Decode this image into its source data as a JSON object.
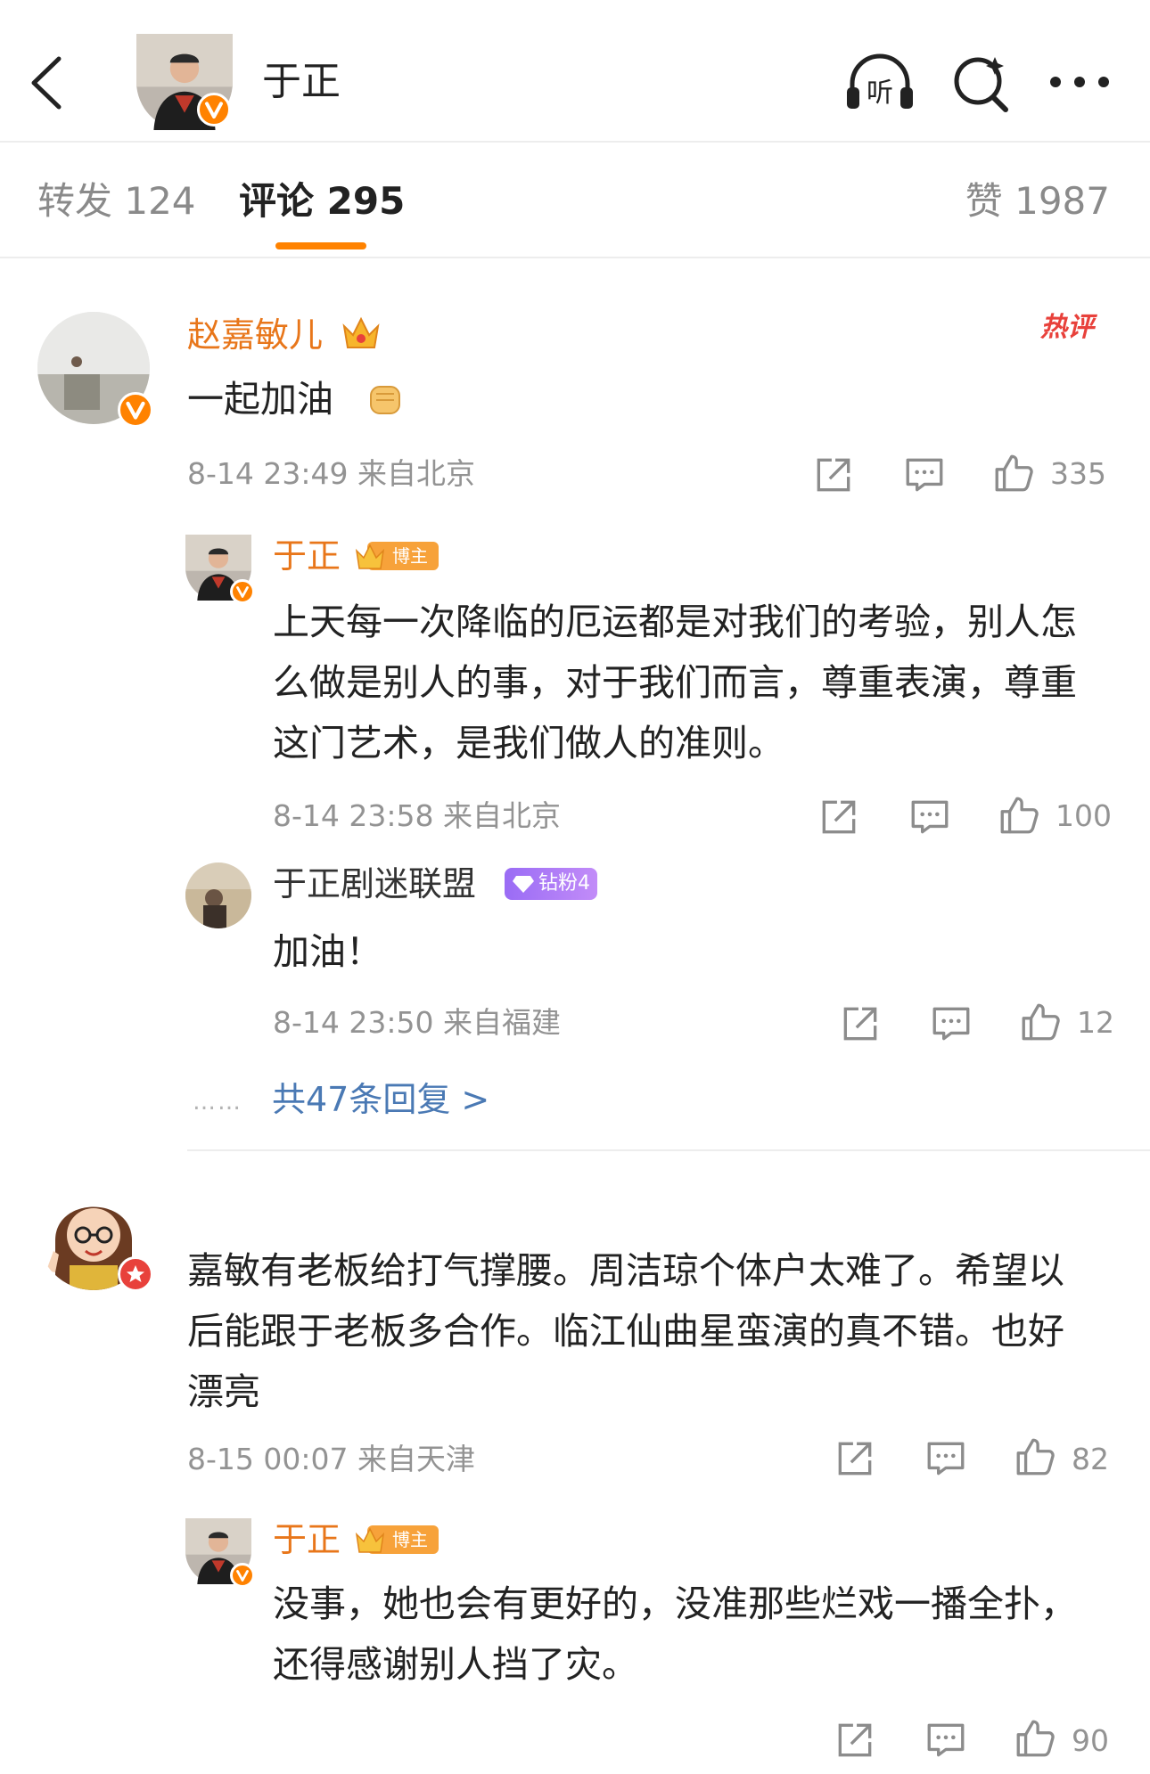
{
  "header": {
    "title": "于正",
    "listen_label": "听"
  },
  "tabs": {
    "repost": "转发 124",
    "comment": "评论 295",
    "like": "赞 1987"
  },
  "comments": [
    {
      "name": "赵嘉敏儿",
      "text": "一起加油",
      "hot_tag": "热评",
      "meta": "8-14 23:49 来自北京",
      "likes": "335",
      "replies": [
        {
          "name": "于正",
          "badge": "博主",
          "text": "上天每一次降临的厄运都是对我们的考验，别人怎么做是别人的事，对于我们而言，尊重表演，尊重这门艺术，是我们做人的准则。",
          "meta": "8-14 23:58 来自北京",
          "likes": "100"
        },
        {
          "name": "于正剧迷联盟",
          "badge": "钻粉4",
          "text": "加油！",
          "meta": "8-14 23:50 来自福建",
          "likes": "12"
        }
      ],
      "more_replies": "共47条回复 >"
    },
    {
      "name": "",
      "text": "嘉敏有老板给打气撑腰。周洁琼个体户太难了。希望以后能跟于老板多合作。临江仙曲星蛮演的真不错。也好漂亮",
      "meta": "8-15 00:07 来自天津",
      "likes": "82",
      "replies": [
        {
          "name": "于正",
          "badge": "博主",
          "text": "没事，她也会有更好的，没准那些烂戏一播全扑，还得感谢别人挡了灾。",
          "likes": "90"
        }
      ]
    }
  ],
  "colors": {
    "accent": "#ff8200",
    "name_orange": "#e8761a",
    "link_blue": "#4a79b4",
    "hot_red": "#e8413b"
  }
}
